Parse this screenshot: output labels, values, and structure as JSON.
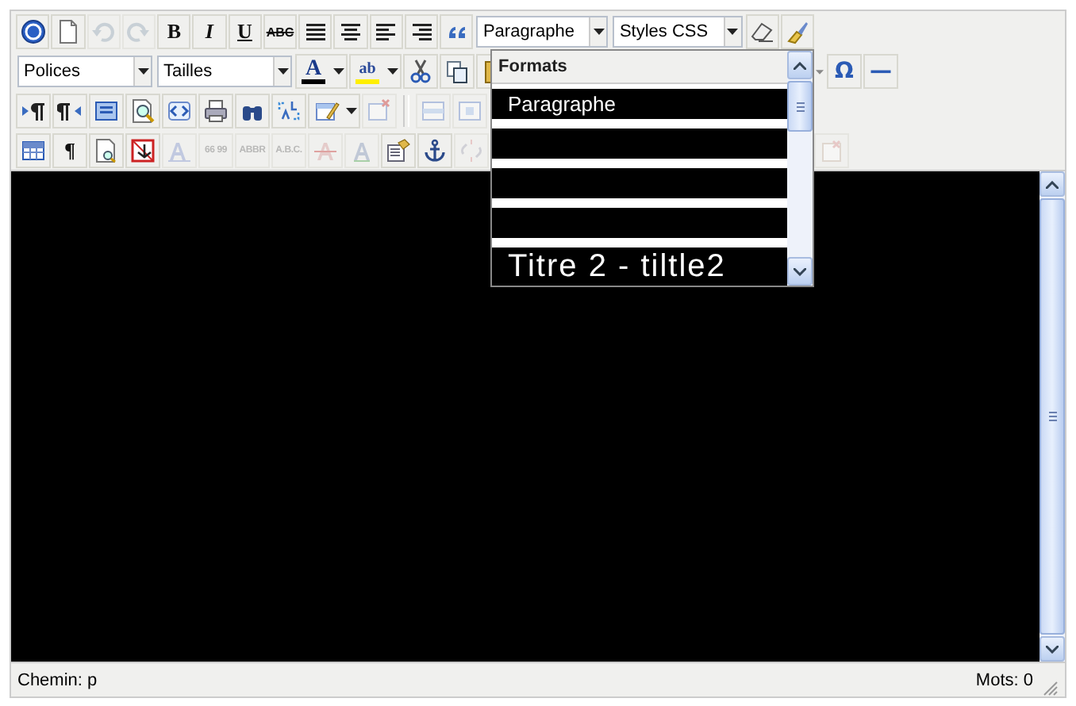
{
  "toolbars": [
    {
      "left": [
        {
          "kind": "button",
          "disabled": false
        },
        {
          "kind": "button",
          "disabled": false
        },
        {
          "kind": "button",
          "disabled": true
        },
        {
          "kind": "button",
          "disabled": true
        },
        {
          "kind": "glyph",
          "label": "B",
          "disabled": false
        },
        {
          "kind": "glyph",
          "label": "I",
          "disabled": false
        },
        {
          "kind": "glyph",
          "label": "U",
          "disabled": false
        },
        {
          "kind": "glyph",
          "label": "ABC",
          "disabled": false
        },
        {
          "kind": "button",
          "disabled": false
        },
        {
          "kind": "button",
          "disabled": false
        },
        {
          "kind": "button",
          "disabled": false
        },
        {
          "kind": "button",
          "disabled": false
        },
        {
          "kind": "button",
          "disabled": false
        },
        {
          "kind": "select",
          "value": "Paragraphe"
        },
        {
          "kind": "select",
          "value": "Styles CSS"
        },
        {
          "kind": "button",
          "disabled": false
        },
        {
          "kind": "button",
          "disabled": false
        }
      ]
    },
    {
      "left": [
        {
          "kind": "select",
          "value": "Polices"
        },
        {
          "kind": "select",
          "value": "Tailles"
        },
        {
          "kind": "split",
          "label": "A",
          "disabled": false
        },
        {
          "kind": "split",
          "label": "ab",
          "disabled": false
        },
        {
          "kind": "button",
          "disabled": false
        },
        {
          "kind": "button",
          "disabled": false
        },
        {
          "kind": "button",
          "disabled": false
        }
      ],
      "right": [
        {
          "kind": "arrow"
        },
        {
          "kind": "glyph",
          "label": "Ω",
          "disabled": false
        },
        {
          "kind": "glyph",
          "label": "—",
          "disabled": false
        }
      ]
    },
    {
      "left": [
        {
          "kind": "button",
          "disabled": false
        },
        {
          "kind": "button",
          "disabled": false
        },
        {
          "kind": "button",
          "disabled": false
        },
        {
          "kind": "button",
          "disabled": false
        },
        {
          "kind": "button",
          "disabled": false
        },
        {
          "kind": "button",
          "disabled": false
        },
        {
          "kind": "button",
          "disabled": false
        },
        {
          "kind": "button",
          "disabled": false
        },
        {
          "kind": "split",
          "disabled": false
        },
        {
          "kind": "button",
          "disabled": true
        },
        {
          "kind": "separator"
        },
        {
          "kind": "button",
          "disabled": true
        },
        {
          "kind": "button",
          "disabled": true
        }
      ]
    },
    {
      "left": [
        {
          "kind": "button",
          "disabled": false
        },
        {
          "kind": "glyph",
          "label": "¶",
          "disabled": false
        },
        {
          "kind": "button",
          "disabled": false
        },
        {
          "kind": "button",
          "disabled": false
        },
        {
          "kind": "button",
          "disabled": true
        },
        {
          "kind": "glyph",
          "label": "66 99",
          "disabled": true
        },
        {
          "kind": "glyph",
          "label": "ABBR",
          "disabled": true
        },
        {
          "kind": "glyph",
          "label": "A.B.C.",
          "disabled": true
        },
        {
          "kind": "button",
          "disabled": true
        },
        {
          "kind": "button",
          "disabled": true
        },
        {
          "kind": "button",
          "disabled": false
        },
        {
          "kind": "button",
          "disabled": false
        },
        {
          "kind": "button",
          "disabled": true
        }
      ],
      "right": [
        {
          "kind": "button",
          "disabled": true
        }
      ]
    }
  ],
  "format_menu": {
    "title": "Formats",
    "items": [
      {
        "kind": "text",
        "label": "Paragraphe"
      },
      {
        "kind": "blank"
      },
      {
        "kind": "blank"
      },
      {
        "kind": "blank"
      },
      {
        "kind": "heading",
        "label": "Titre 2 - tiltle2"
      }
    ]
  },
  "status_bar": {
    "path": "Chemin: p",
    "word_count": "Mots: 0"
  }
}
